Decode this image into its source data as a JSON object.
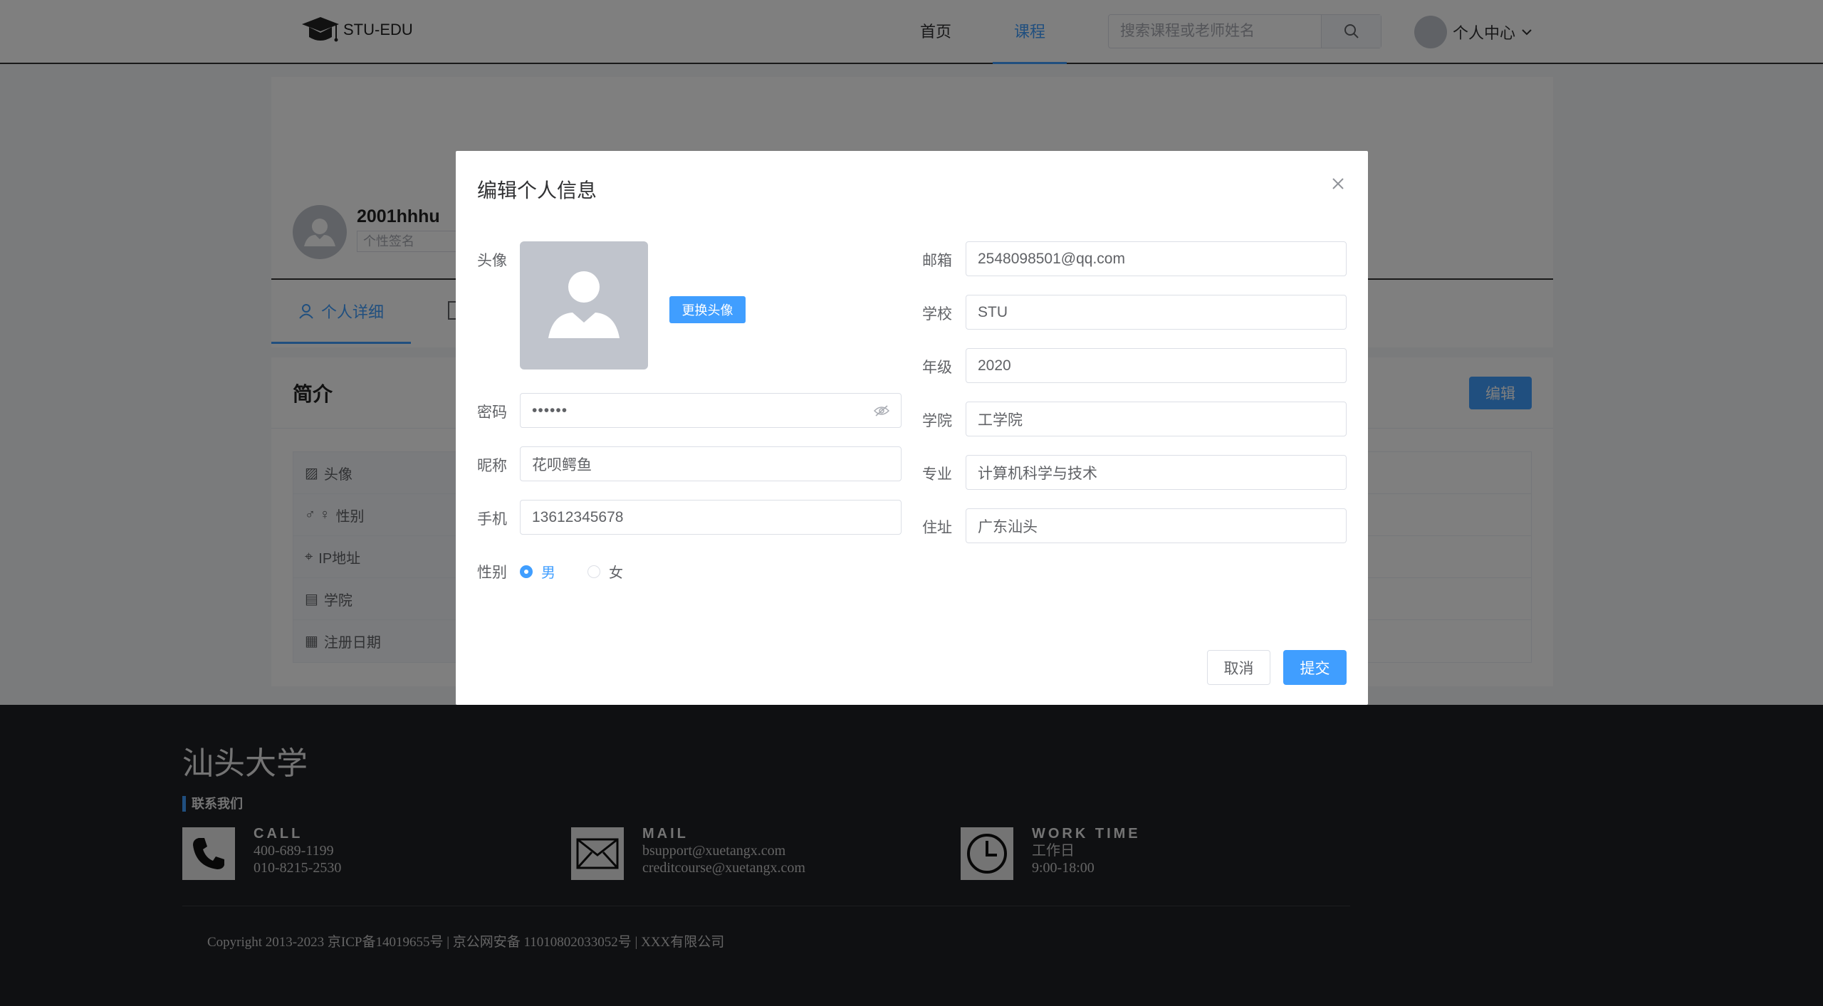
{
  "header": {
    "logo_text": "STU-EDU",
    "nav": [
      "首页",
      "课程"
    ],
    "active_nav": "课程",
    "search_placeholder": "搜索课程或老师姓名",
    "user_menu_label": "个人中心"
  },
  "profile": {
    "username": "2001hhhu",
    "signature_placeholder": "个性签名",
    "tab_label": "个人详细",
    "intro_title": "简介",
    "edit_label": "编辑",
    "rows": [
      "头像",
      "性别",
      "IP地址",
      "学院",
      "注册日期"
    ]
  },
  "modal": {
    "title": "编辑个人信息",
    "avatar_label": "头像",
    "change_avatar_label": "更换头像",
    "password_label": "密码",
    "password_value": "••••••",
    "nickname_label": "昵称",
    "nickname_value": "花呗鳄鱼",
    "phone_label": "手机",
    "phone_value": "13612345678",
    "gender_label": "性别",
    "gender_options": [
      "男",
      "女"
    ],
    "gender_selected": "男",
    "email_label": "邮箱",
    "email_value": "2548098501@qq.com",
    "school_label": "学校",
    "school_value": "STU",
    "grade_label": "年级",
    "grade_value": "2020",
    "college_label": "学院",
    "college_value": "工学院",
    "major_label": "专业",
    "major_value": "计算机科学与技术",
    "address_label": "住址",
    "address_value": "广东汕头",
    "cancel_label": "取消",
    "submit_label": "提交"
  },
  "footer": {
    "school_name": "汕头大学",
    "contact_heading": "联系我们",
    "call": {
      "title": "CALL",
      "lines": [
        "400-689-1199",
        "010-8215-2530"
      ]
    },
    "mail": {
      "title": "MAIL",
      "lines": [
        "bsupport@xuetangx.com",
        "creditcourse@xuetangx.com"
      ]
    },
    "work": {
      "title": "WORK TIME",
      "lines": [
        "工作日",
        "9:00-18:00"
      ]
    },
    "copyright": "Copyright 2013-2023 京ICP备14019655号 | 京公网安备 11010802033052号 | XXX有限公司"
  },
  "colors": {
    "primary": "#409eff",
    "footer_bg": "#1f2025",
    "overlay": "rgba(0,0,0,0.5)"
  }
}
